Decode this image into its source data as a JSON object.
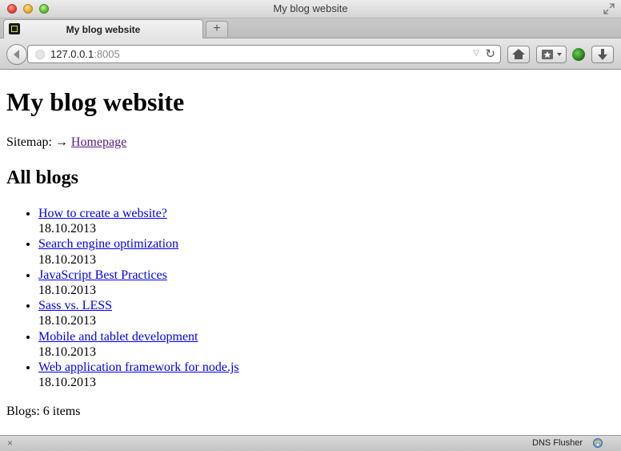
{
  "window": {
    "title": "My blog website"
  },
  "tabs": [
    {
      "label": "My blog website"
    }
  ],
  "toolbar": {
    "url_host": "127.0.0.1",
    "url_port": ":8005",
    "new_tab_label": "+"
  },
  "page": {
    "heading": "My blog website",
    "sitemap": {
      "prefix": "Sitemap: →",
      "link": "Homepage"
    },
    "section_heading": "All blogs",
    "blogs": [
      {
        "title": "How to create a website?",
        "date": "18.10.2013"
      },
      {
        "title": "Search engine optimization",
        "date": "18.10.2013"
      },
      {
        "title": "JavaScript Best Practices",
        "date": "18.10.2013"
      },
      {
        "title": "Sass vs. LESS",
        "date": "18.10.2013"
      },
      {
        "title": "Mobile and tablet development",
        "date": "18.10.2013"
      },
      {
        "title": "Web application framework for node.js",
        "date": "18.10.2013"
      }
    ],
    "count": "Blogs: 6 items"
  },
  "statusbar": {
    "close_glyph": "×",
    "extension_label": "DNS Flusher"
  },
  "icons": {
    "back": "back-arrow-icon",
    "home": "home-icon",
    "bookmark": "bookmark-icon",
    "download": "download-icon",
    "reload": "reload-icon",
    "extension": "green-orb-icon"
  },
  "colors": {
    "link": "#0000ee",
    "visited_link": "#551a8b"
  }
}
